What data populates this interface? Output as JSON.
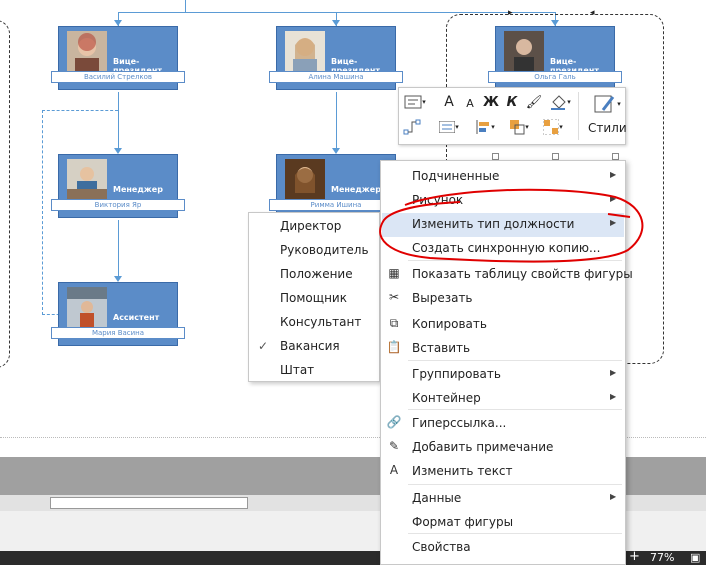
{
  "org_chart": {
    "cards": [
      {
        "title": "Вице-президент",
        "name": "Василий Стрелков"
      },
      {
        "title": "Вице-президент",
        "name": "Алина Машина"
      },
      {
        "title": "Вице-президент",
        "name": "Ольга Галь"
      },
      {
        "title": "Менеджер",
        "name": "Виктория Яр"
      },
      {
        "title": "Менеджер",
        "name": "Римма Ишина"
      },
      {
        "title": "Ассистент",
        "name": "Мария Васина"
      }
    ]
  },
  "mini_toolbar": {
    "styles_label": "Стили",
    "bold": "Ж",
    "italic": "К",
    "font_grow": "A",
    "font_shrink": "A"
  },
  "position_submenu": {
    "items": [
      "Директор",
      "Руководитель",
      "Положение",
      "Помощник",
      "Консультант",
      "Вакансия",
      "Штат"
    ],
    "checked_index": 5
  },
  "context_menu": {
    "items": [
      {
        "label": "Подчиненные",
        "icon": "",
        "submenu": true
      },
      {
        "label": "Рисунок",
        "icon": "",
        "submenu": true
      },
      {
        "label": "Изменить тип должности",
        "icon": "",
        "submenu": true
      },
      {
        "label": "Создать синхронную копию...",
        "icon": "",
        "submenu": false
      },
      {
        "label": "Показать таблицу свойств фигуры",
        "icon": "table-icon",
        "submenu": false
      },
      {
        "label": "Вырезать",
        "icon": "scissors-icon",
        "submenu": false
      },
      {
        "label": "Копировать",
        "icon": "copy-icon",
        "submenu": false
      },
      {
        "label": "Вставить",
        "icon": "paste-icon",
        "submenu": false
      },
      {
        "label": "Группировать",
        "icon": "",
        "submenu": true
      },
      {
        "label": "Контейнер",
        "icon": "",
        "submenu": true
      },
      {
        "label": "Гиперссылка...",
        "icon": "hyperlink-icon",
        "submenu": false
      },
      {
        "label": "Добавить примечание",
        "icon": "comment-icon",
        "submenu": false
      },
      {
        "label": "Изменить текст",
        "icon": "text-icon",
        "submenu": false
      },
      {
        "label": "Данные",
        "icon": "",
        "submenu": true
      },
      {
        "label": "Формат фигуры",
        "icon": "",
        "submenu": false
      },
      {
        "label": "Свойства",
        "icon": "",
        "submenu": false
      }
    ],
    "highlighted_index": 2
  },
  "status_bar": {
    "zoom": "77%",
    "zoom_in": "+"
  },
  "colors": {
    "card_fill": "#5b8cc8",
    "connector": "#5b9bd5",
    "highlight": "#dbe6f5",
    "annotation": "#e00000"
  }
}
